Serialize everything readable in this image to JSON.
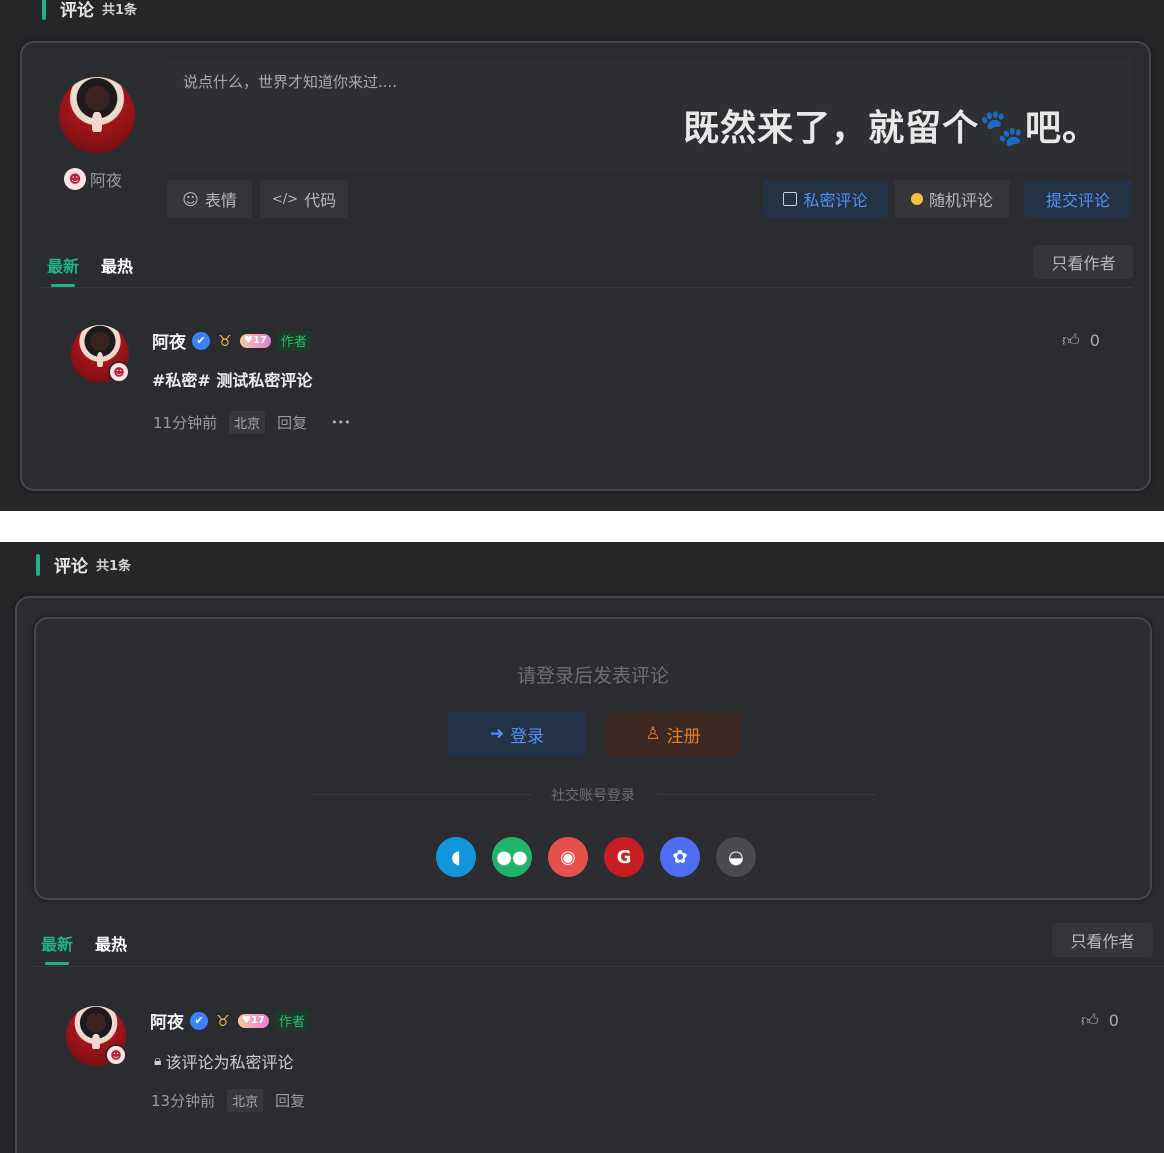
{
  "section": {
    "title": "评论",
    "count": "共1条"
  },
  "editor": {
    "placeholder": "说点什么，世界才知道你来过....",
    "slogan": "既然来了，就留个🐾吧。",
    "user_name": "阿夜",
    "emoji_btn": "表情",
    "code_btn": "代码",
    "private_btn": "私密评论",
    "random_btn": "随机评论",
    "submit_btn": "提交评论"
  },
  "login_box": {
    "prompt": "请登录后发表评论",
    "login_btn": "登录",
    "register_btn": "注册",
    "social_label": "社交账号登录",
    "social_icons": [
      {
        "name": "qq-icon",
        "color": "#1296db"
      },
      {
        "name": "wechat-icon",
        "color": "#20b56b"
      },
      {
        "name": "weibo-icon",
        "color": "#e8504e"
      },
      {
        "name": "gitee-icon",
        "color": "#c71d23"
      },
      {
        "name": "baidu-icon",
        "color": "#4e6ef2"
      },
      {
        "name": "github-icon",
        "color": "#4a4b4f"
      }
    ]
  },
  "tabs": {
    "latest": "最新",
    "hottest": "最热",
    "author_only": "只看作者"
  },
  "comment1": {
    "author": "阿夜",
    "level": "17",
    "author_tag": "作者",
    "text": "#私密# 测试私密评论",
    "time": "11分钟前",
    "location": "北京",
    "reply": "回复",
    "more": "•••",
    "likes": "0"
  },
  "comment2": {
    "author": "阿夜",
    "level": "17",
    "author_tag": "作者",
    "text": "该评论为私密评论",
    "time": "13分钟前",
    "location": "北京",
    "reply": "回复",
    "likes": "0"
  },
  "colors": {
    "accent": "#21b18a",
    "blue": "#4f92f2",
    "orange": "#e87a24",
    "background": "#252628"
  }
}
